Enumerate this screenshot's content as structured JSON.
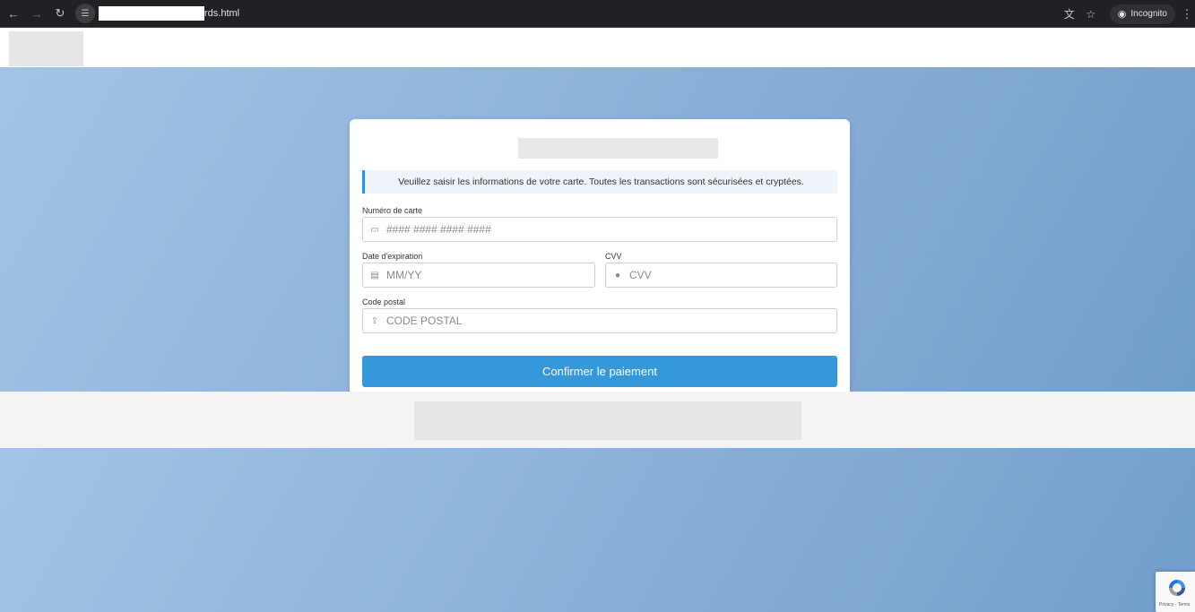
{
  "browser": {
    "url_suffix": "rds.html",
    "incognito_label": "Incognito",
    "icons": {
      "back": "arrow-left-icon",
      "forward": "arrow-right-icon",
      "reload": "reload-icon",
      "site_info": "tune-icon",
      "translate": "translate-icon",
      "bookmark": "star-icon",
      "incognito": "incognito-icon",
      "menu": "kebab-menu-icon"
    }
  },
  "form": {
    "info_text": "Veuillez saisir les informations de votre carte. Toutes les transactions sont sécurisées et cryptées.",
    "card_number": {
      "label": "Numéro de carte",
      "placeholder": "#### #### #### ####",
      "value": ""
    },
    "expiry": {
      "label": "Date d'expiration",
      "placeholder": "MM/YY",
      "value": ""
    },
    "cvv": {
      "label": "CVV",
      "placeholder": "CVV",
      "value": ""
    },
    "postal": {
      "label": "Code postal",
      "placeholder": "CODE POSTAL",
      "value": ""
    },
    "submit_label": "Confirmer le paiement"
  },
  "recaptcha": {
    "links": "Privacy - Terms"
  },
  "colors": {
    "accent": "#3498db",
    "info_border": "#3a8fd8",
    "hero_start": "#a2c4e6",
    "hero_end": "#729ecc"
  }
}
